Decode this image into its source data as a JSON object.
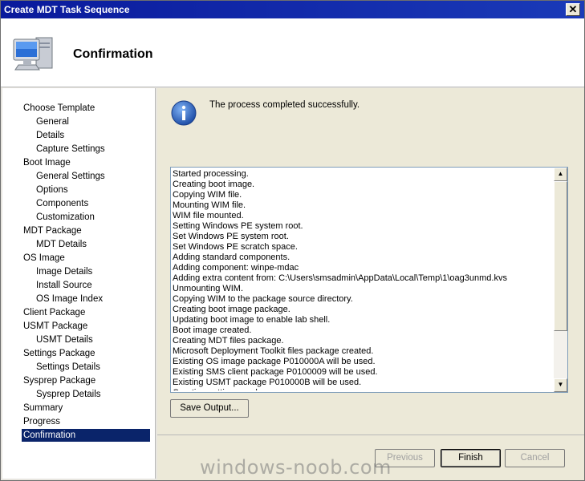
{
  "window": {
    "title": "Create MDT Task Sequence"
  },
  "header": {
    "title": "Confirmation",
    "icon": "computer-icon"
  },
  "nav": {
    "items": [
      {
        "label": "Choose Template",
        "level": 0
      },
      {
        "label": "General",
        "level": 1
      },
      {
        "label": "Details",
        "level": 1
      },
      {
        "label": "Capture Settings",
        "level": 1
      },
      {
        "label": "Boot Image",
        "level": 0
      },
      {
        "label": "General Settings",
        "level": 1
      },
      {
        "label": "Options",
        "level": 1
      },
      {
        "label": "Components",
        "level": 1
      },
      {
        "label": "Customization",
        "level": 1
      },
      {
        "label": "MDT Package",
        "level": 0
      },
      {
        "label": "MDT Details",
        "level": 1
      },
      {
        "label": "OS Image",
        "level": 0
      },
      {
        "label": "Image Details",
        "level": 1
      },
      {
        "label": "Install Source",
        "level": 1
      },
      {
        "label": "OS Image Index",
        "level": 1
      },
      {
        "label": "Client Package",
        "level": 0
      },
      {
        "label": "USMT Package",
        "level": 0
      },
      {
        "label": "USMT Details",
        "level": 1
      },
      {
        "label": "Settings Package",
        "level": 0
      },
      {
        "label": "Settings Details",
        "level": 1
      },
      {
        "label": "Sysprep Package",
        "level": 0
      },
      {
        "label": "Sysprep Details",
        "level": 1
      },
      {
        "label": "Summary",
        "level": 0
      },
      {
        "label": "Progress",
        "level": 0
      },
      {
        "label": "Confirmation",
        "level": 0,
        "selected": true
      }
    ]
  },
  "content": {
    "status_text": "The process completed successfully.",
    "log": [
      "Started processing.",
      "Creating boot image.",
      "Copying WIM file.",
      "Mounting WIM file.",
      "WIM file mounted.",
      "Setting Windows PE system root.",
      "Set Windows PE system root.",
      "Set Windows PE scratch space.",
      "Adding standard components.",
      "Adding component: winpe-mdac",
      "Adding extra content from: C:\\Users\\smsadmin\\AppData\\Local\\Temp\\1\\oag3unmd.kvs",
      "Unmounting WIM.",
      "Copying WIM to the package source directory.",
      "Creating boot image package.",
      "Updating boot image to enable lab shell.",
      "Boot image created.",
      "Creating MDT files package.",
      "Microsoft Deployment Toolkit files package created.",
      "Existing OS image package P010000A will be used.",
      "Existing SMS client package P0100009 will be used.",
      "Existing USMT package P010000B will be used.",
      "Creating settings package."
    ],
    "save_output_label": "Save Output..."
  },
  "footer": {
    "previous_label": "Previous",
    "finish_label": "Finish",
    "cancel_label": "Cancel"
  },
  "watermark": "windows-noob.com",
  "colors": {
    "titlebar": "#0a1a9c",
    "selected": "#0a246a",
    "info_icon": "#1f5bb8"
  }
}
